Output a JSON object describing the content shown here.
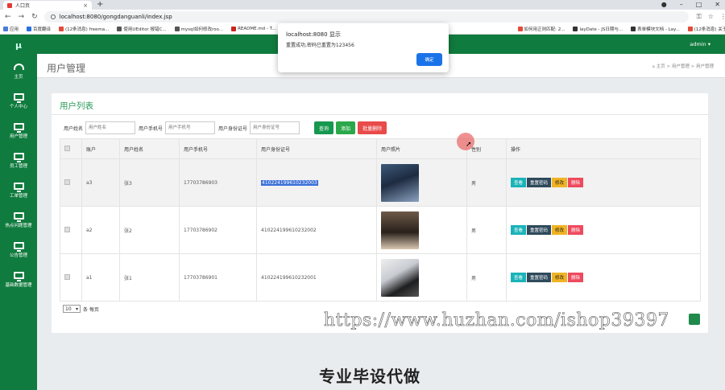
{
  "browser": {
    "tab_title": "人口页",
    "url": "localhost:8080/gongdanguanli/index.jsp",
    "bookmarks": [
      "应用",
      "百度翻译",
      "(12条消息) freema...",
      "使用UEditor 报错C...",
      "mysql如何修改roo...",
      "README.md - T...",
      "如何用正则匹配: 2...",
      "layDate - JS日期与...",
      "表单模块文档 - Lay...",
      "(12条消息) 关于lay..."
    ]
  },
  "dialog": {
    "title": "localhost:8080 显示",
    "message": "重置成功,密码已重置为123456",
    "ok_label": "确定"
  },
  "sidebar": {
    "logo": "μ",
    "items": [
      {
        "label": "主页",
        "icon": "dashboard-icon"
      },
      {
        "label": "个人中心",
        "icon": "monitor-icon"
      },
      {
        "label": "用户管理",
        "icon": "monitor-icon"
      },
      {
        "label": "员工管理",
        "icon": "monitor-icon"
      },
      {
        "label": "工单管理",
        "icon": "monitor-icon"
      },
      {
        "label": "热点问题管理",
        "icon": "monitor-icon"
      },
      {
        "label": "公告管理",
        "icon": "monitor-icon"
      },
      {
        "label": "基础数据管理",
        "icon": "monitor-icon"
      }
    ]
  },
  "topbar": {
    "user": "admin ▾"
  },
  "header": {
    "title": "用户管理",
    "breadcrumb": "主页  >  用户管理  >  用户管理"
  },
  "card": {
    "title": "用户列表",
    "filters": [
      {
        "label": "用户姓名",
        "placeholder": "用户姓名"
      },
      {
        "label": "用户手机号",
        "placeholder": "用户手机号"
      },
      {
        "label": "用户身份证号",
        "placeholder": "用户身份证号"
      }
    ],
    "buttons": {
      "search": "查询",
      "add": "添加",
      "batch_delete": "批量删除"
    }
  },
  "table": {
    "headers": [
      "",
      "账户",
      "用户姓名",
      "用户手机号",
      "用户身份证号",
      "用户照片",
      "性别",
      "操作"
    ],
    "rows": [
      {
        "account": "a3",
        "name": "张3",
        "phone": "17703786903",
        "id_card": "410224199610232003",
        "gender": "男"
      },
      {
        "account": "a2",
        "name": "张2",
        "phone": "17703786902",
        "id_card": "410224199610232002",
        "gender": "男"
      },
      {
        "account": "a1",
        "name": "张1",
        "phone": "17703786901",
        "id_card": "410224199610232001",
        "gender": "男"
      }
    ],
    "actions": {
      "view": "查看",
      "reset": "重置密码",
      "edit": "修改",
      "delete": "删除"
    }
  },
  "pager": {
    "size": "10",
    "suffix": "条 每页"
  },
  "watermark": "https://www.huzhan.com/ishop39397",
  "banner": "专业毕设代做"
}
